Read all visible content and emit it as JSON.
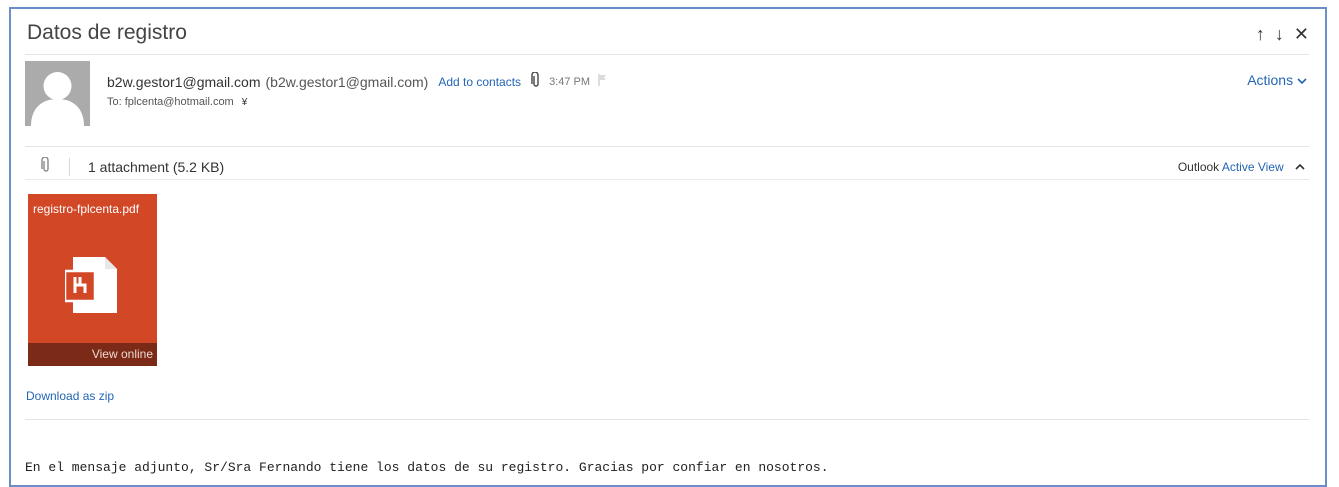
{
  "message": {
    "subject": "Datos de registro",
    "nav": {
      "up": "↑",
      "down": "↓",
      "close": "✕"
    },
    "sender": {
      "name": "b2w.gestor1@gmail.com",
      "address": "(b2w.gestor1@gmail.com)",
      "add_contacts": "Add to contacts",
      "time": "3:47 PM"
    },
    "recipients": {
      "to": "To: fplcenta@hotmail.com",
      "expand": "¥"
    },
    "actions_label": "Actions",
    "attachments": {
      "summary": "1 attachment (5.2 KB)",
      "outlook_label": "Outlook",
      "active_view": "Active View",
      "file_name": "registro-fplcenta.pdf",
      "view_online": "View online",
      "download_zip": "Download as zip"
    },
    "body": "En el mensaje adjunto, Sr/Sra Fernando tiene los datos de su registro. Gracias por confiar en nosotros."
  },
  "colors": {
    "accent": "#2465b5",
    "tile": "#d24726",
    "tile_footer": "#7a2a17",
    "frame_border": "#6a8fc8"
  },
  "icons": [
    "arrow-up-icon",
    "arrow-down-icon",
    "close-icon",
    "avatar-icon",
    "paperclip-icon",
    "flag-icon",
    "chevron-down-icon",
    "chevron-up-icon",
    "pdf-file-icon"
  ]
}
